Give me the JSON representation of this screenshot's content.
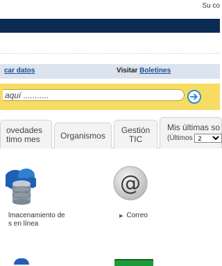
{
  "header": {
    "greeting": "Su co"
  },
  "links": {
    "left_link": "car datos",
    "visit_prefix": "Visitar",
    "visit_link": "Boletines"
  },
  "search": {
    "value": "aquí ..........."
  },
  "tabs": [
    {
      "line1": "ovedades",
      "line2": "timo mes"
    },
    {
      "label": "Organismos"
    },
    {
      "line1": "Gestión",
      "line2": "TIC"
    },
    {
      "line1": "Mis últimas so",
      "sub_prefix": "(Últimos",
      "select_value": "2"
    }
  ],
  "services": [
    {
      "icon": "database-cloud-icon",
      "line1": "lmacenamiento de",
      "line2": "s en línea"
    },
    {
      "icon": "at-sign-icon",
      "label": "Correo"
    }
  ],
  "colors": {
    "banner": "#0b2c52",
    "search_bar": "#f7dc64",
    "link": "#1a4f8f",
    "accent_blue": "#2e8ed0"
  }
}
